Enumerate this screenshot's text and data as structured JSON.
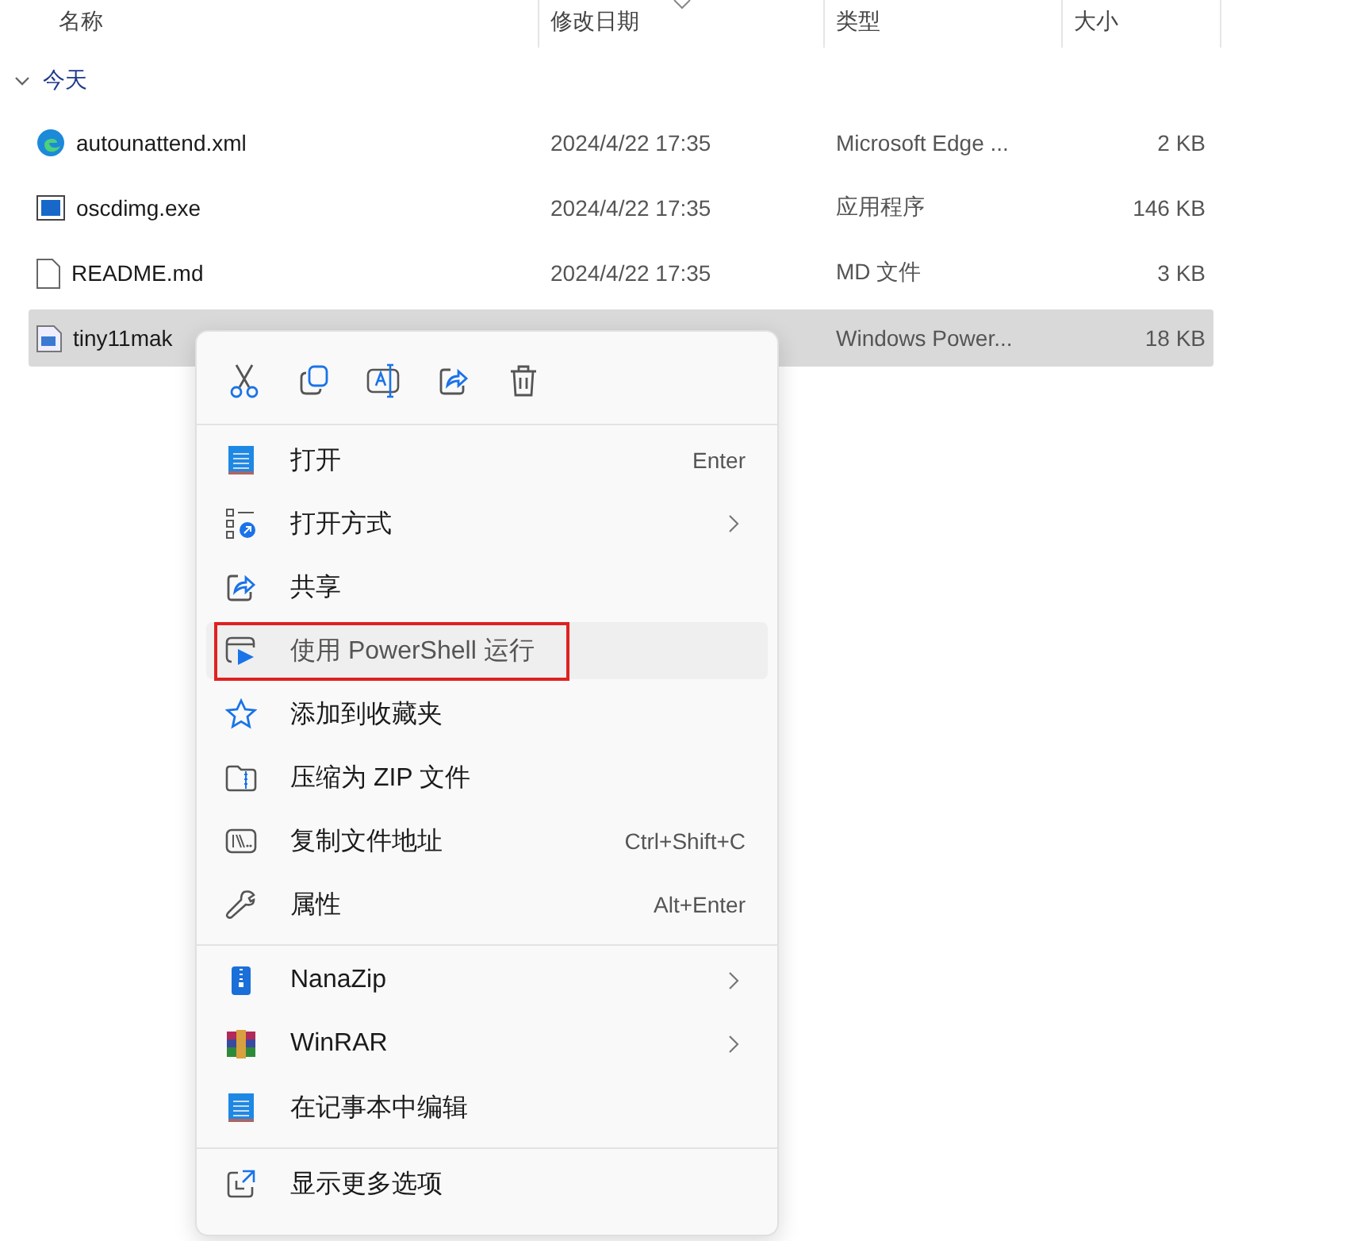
{
  "columns": [
    "名称",
    "修改日期",
    "类型",
    "大小"
  ],
  "group": {
    "label": "今天",
    "expanded": true
  },
  "files": [
    {
      "name": "autounattend.xml",
      "date": "2024/4/22 17:35",
      "type": "Microsoft Edge ...",
      "size": "2 KB",
      "selected": false
    },
    {
      "name": "oscdimg.exe",
      "date": "2024/4/22 17:35",
      "type": "应用程序",
      "size": "146 KB",
      "selected": false
    },
    {
      "name": "README.md",
      "date": "2024/4/22 17:35",
      "type": "MD 文件",
      "size": "3 KB",
      "selected": false
    },
    {
      "name": "tiny11mak",
      "type": "Windows Power...",
      "size": "18 KB",
      "selected": true
    }
  ],
  "menu": {
    "sections": [
      [
        {
          "label": "打开",
          "shortcut": "Enter",
          "submenu": false,
          "hovered": false,
          "outlined": false
        },
        {
          "label": "打开方式",
          "submenu": true,
          "hovered": false,
          "outlined": false
        },
        {
          "label": "共享",
          "submenu": false,
          "hovered": false,
          "outlined": false
        },
        {
          "label": "使用 PowerShell 运行",
          "submenu": false,
          "hovered": true,
          "outlined": true
        },
        {
          "label": "添加到收藏夹",
          "submenu": false,
          "hovered": false,
          "outlined": false
        },
        {
          "label": "压缩为 ZIP 文件",
          "submenu": false,
          "hovered": false,
          "outlined": false
        },
        {
          "label": "复制文件地址",
          "shortcut": "Ctrl+Shift+C",
          "submenu": false,
          "hovered": false,
          "outlined": false
        },
        {
          "label": "属性",
          "shortcut": "Alt+Enter",
          "submenu": false,
          "hovered": false,
          "outlined": false
        }
      ],
      [
        {
          "label": "NanaZip",
          "submenu": true,
          "hovered": false,
          "outlined": false
        },
        {
          "label": "WinRAR",
          "submenu": true,
          "hovered": false,
          "outlined": false
        },
        {
          "label": "在记事本中编辑",
          "submenu": false,
          "hovered": false,
          "outlined": false
        }
      ],
      [
        {
          "label": "显示更多选项",
          "submenu": false,
          "hovered": false,
          "outlined": false
        }
      ]
    ]
  }
}
